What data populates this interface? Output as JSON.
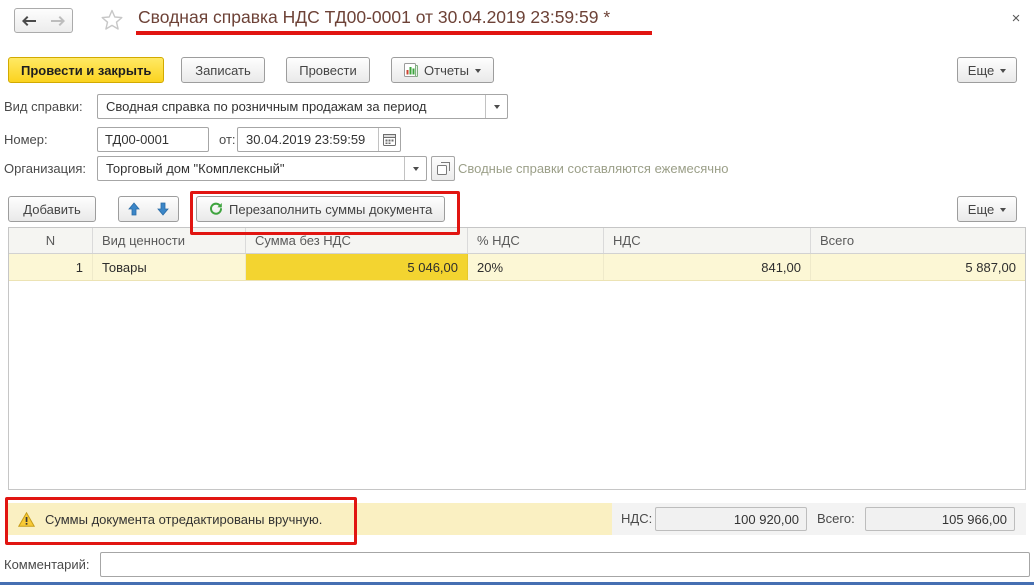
{
  "window": {
    "close_icon": "×"
  },
  "header": {
    "title": "Сводная справка НДС ТД00-0001 от 30.04.2019 23:59:59 *"
  },
  "toolbar": {
    "submit_label": "Провести и закрыть",
    "save_label": "Записать",
    "post_label": "Провести",
    "reports_label": "Отчеты",
    "more_label": "Еще"
  },
  "fields": {
    "kind_label": "Вид справки:",
    "kind_value": "Сводная справка по розничным продажам за период",
    "number_label": "Номер:",
    "number_value": "ТД00-0001",
    "date_label": "от:",
    "date_value": "30.04.2019 23:59:59",
    "org_label": "Организация:",
    "org_value": "Торговый дом \"Комплексный\"",
    "org_note": "Сводные справки составляются ежемесячно"
  },
  "table_toolbar": {
    "add_label": "Добавить",
    "refill_label": "Перезаполнить суммы документа",
    "more_label": "Еще"
  },
  "table": {
    "columns": [
      "N",
      "Вид ценности",
      "Сумма без НДС",
      "% НДС",
      "НДС",
      "Всего"
    ],
    "rows": [
      {
        "n": "1",
        "kind": "Товары",
        "sum_wo_vat": "5 046,00",
        "vat_rate": "20%",
        "vat": "841,00",
        "total": "5 887,00"
      }
    ]
  },
  "footer": {
    "warning_text": "Суммы документа отредактированы вручную.",
    "vat_label": "НДС:",
    "vat_value": "100 920,00",
    "total_label": "Всего:",
    "total_value": "105 966,00",
    "comment_label": "Комментарий:",
    "comment_value": ""
  },
  "colors": {
    "accent_yellow": "#fbd31f",
    "annotation_red": "#e11511",
    "row_highlight": "#fcf7d5",
    "selected_cell": "#f3d430",
    "note_green": "#9b9f88"
  }
}
